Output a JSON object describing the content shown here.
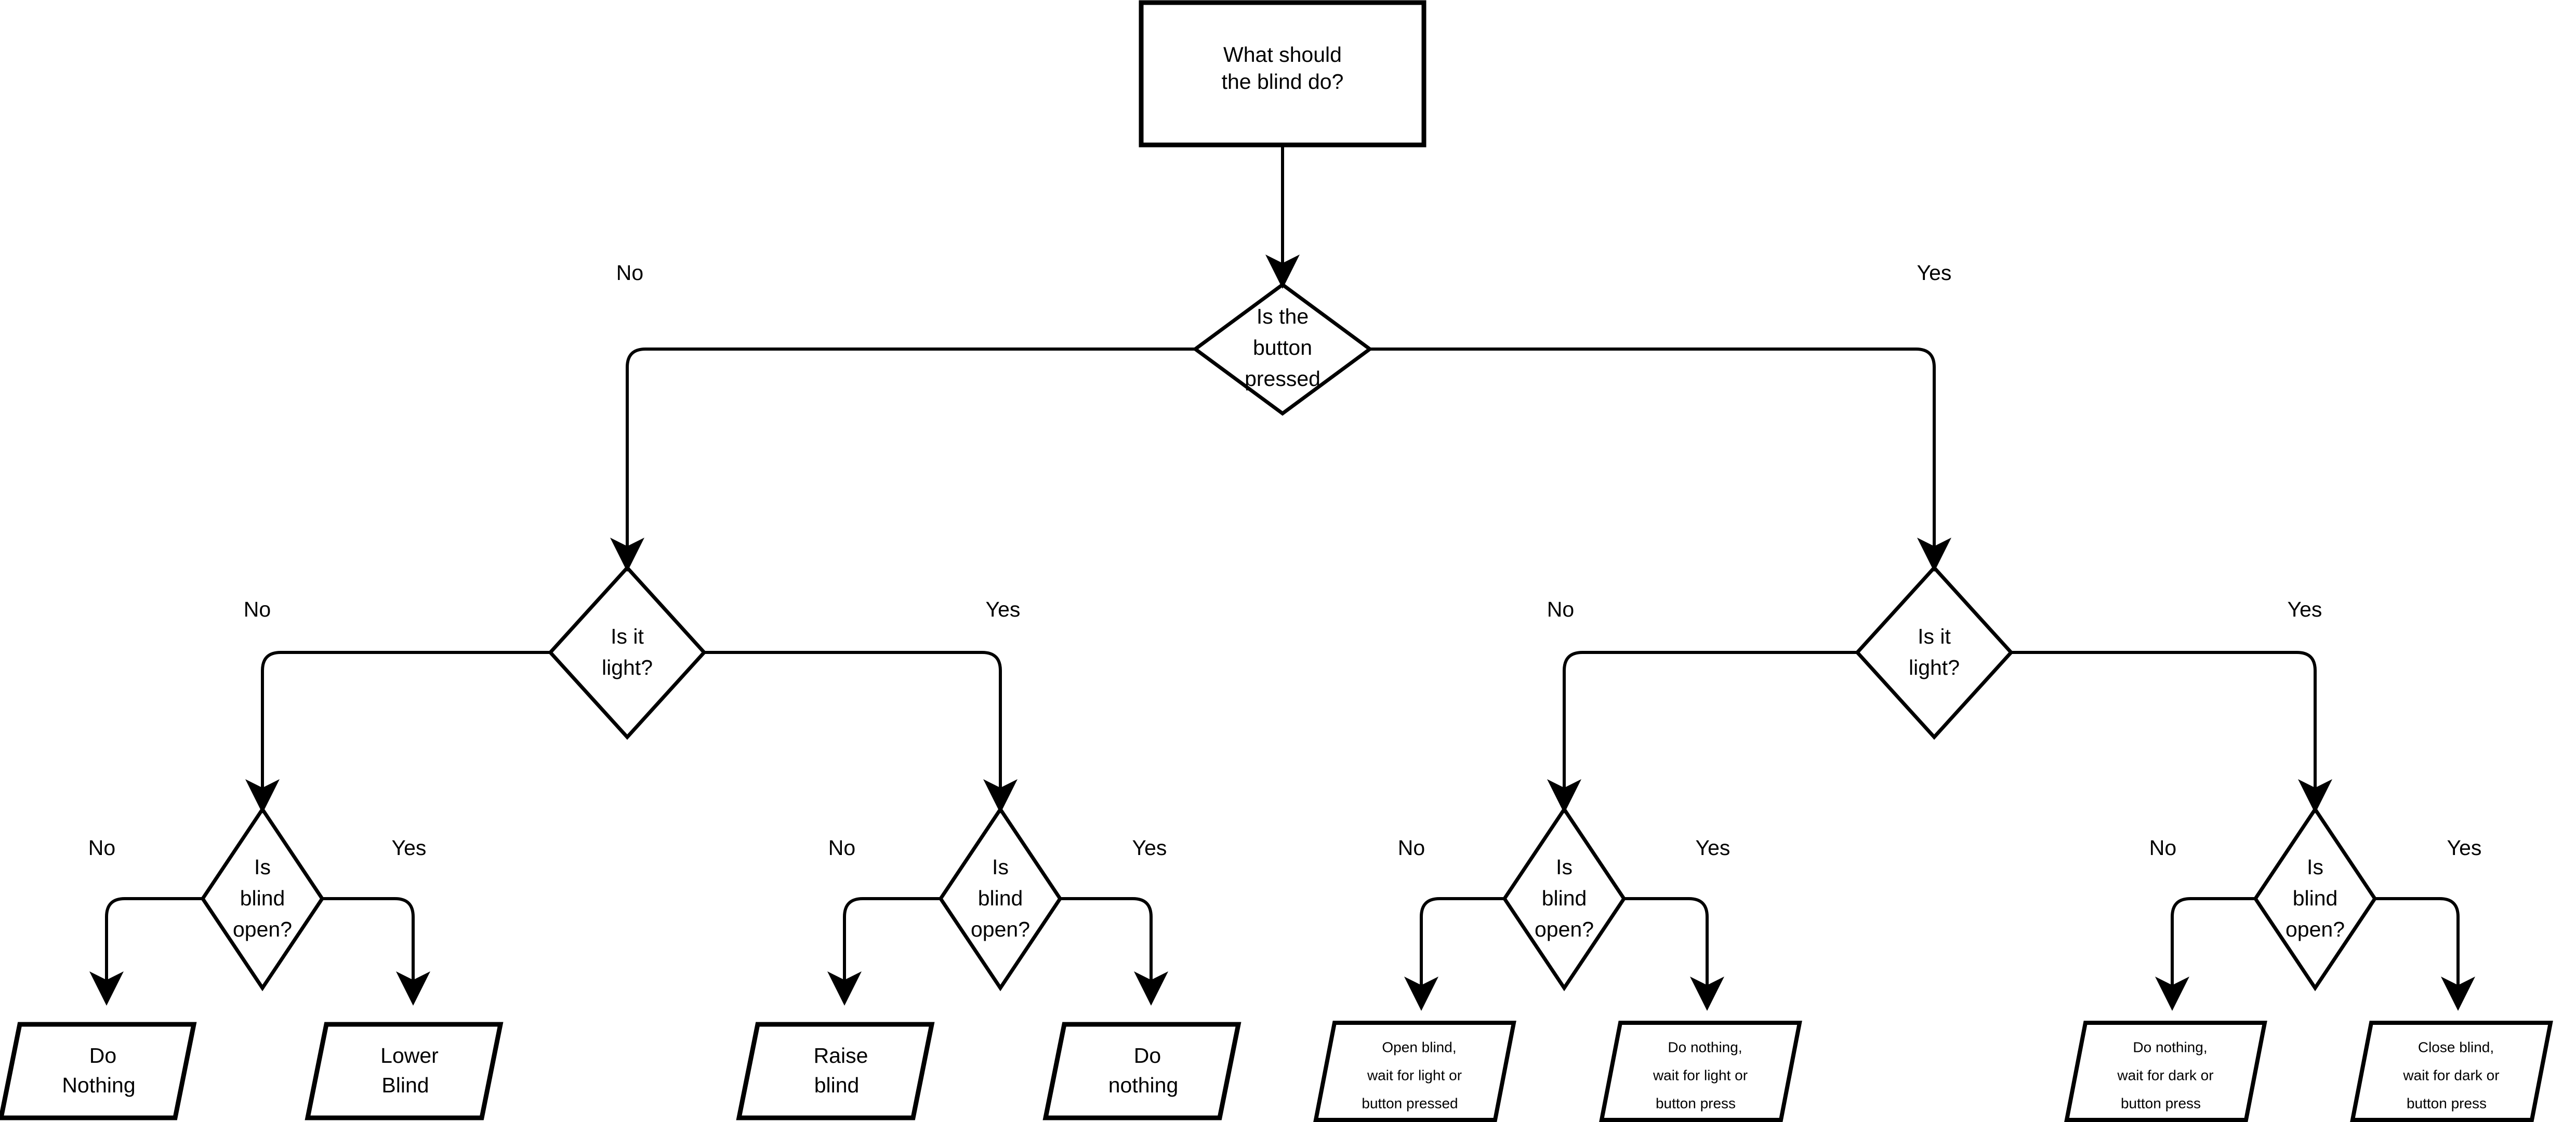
{
  "diagram": {
    "title": "What should the blind do?",
    "type": "flowchart",
    "background_color": "#ffffff",
    "line_color": "#000000",
    "text_color": "#000000"
  },
  "nodes": {
    "start": {
      "shape": "process",
      "line1": "What should",
      "line2": "the blind do?"
    },
    "d_button": {
      "shape": "decision",
      "line1": "Is the",
      "line2": "button",
      "line3": "pressed"
    },
    "d_light_left": {
      "shape": "decision",
      "line1": "Is it",
      "line2": "light?"
    },
    "d_light_right": {
      "shape": "decision",
      "line1": "Is it",
      "line2": "light?"
    },
    "d_open_1": {
      "shape": "decision",
      "line1": "Is",
      "line2": "blind",
      "line3": "open?"
    },
    "d_open_2": {
      "shape": "decision",
      "line1": "Is",
      "line2": "blind",
      "line3": "open?"
    },
    "d_open_3": {
      "shape": "decision",
      "line1": "Is",
      "line2": "blind",
      "line3": "open?"
    },
    "d_open_4": {
      "shape": "decision",
      "line1": "Is",
      "line2": "blind",
      "line3": "open?"
    },
    "io_1": {
      "shape": "io",
      "line1": "Do",
      "line2": "Nothing"
    },
    "io_2": {
      "shape": "io",
      "line1": "Lower",
      "line2": "Blind"
    },
    "io_3": {
      "shape": "io",
      "line1": "Raise",
      "line2": "blind"
    },
    "io_4": {
      "shape": "io",
      "line1": "Do",
      "line2": "nothing"
    },
    "io_5": {
      "shape": "io",
      "line1": "Open blind,",
      "line2": "wait for light or",
      "line3": "button pressed"
    },
    "io_6": {
      "shape": "io",
      "line1": "Do nothing,",
      "line2": "wait for light or",
      "line3": "button press"
    },
    "io_7": {
      "shape": "io",
      "line1": "Do nothing,",
      "line2": "wait for dark or",
      "line3": "button press"
    },
    "io_8": {
      "shape": "io",
      "line1": "Close blind,",
      "line2": "wait for dark or",
      "line3": "button press"
    }
  },
  "edge_labels": {
    "button_no": "No",
    "button_yes": "Yes",
    "light_left_no": "No",
    "light_left_yes": "Yes",
    "light_right_no": "No",
    "light_right_yes": "Yes",
    "open1_no": "No",
    "open1_yes": "Yes",
    "open2_no": "No",
    "open2_yes": "Yes",
    "open3_no": "No",
    "open3_yes": "Yes",
    "open4_no": "No",
    "open4_yes": "Yes"
  }
}
